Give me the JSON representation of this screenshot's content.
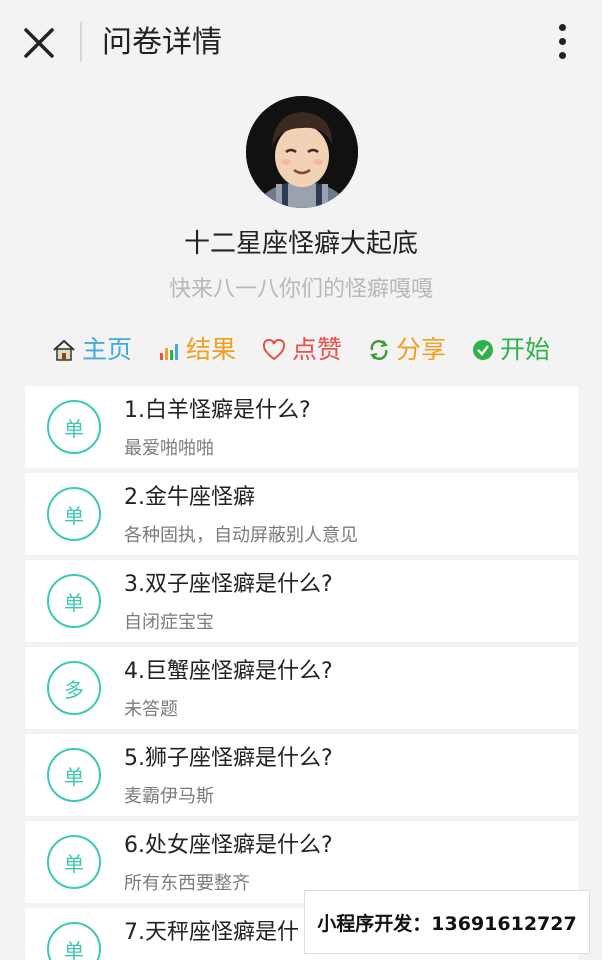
{
  "header": {
    "title": "问卷详情",
    "close_icon": "close-icon",
    "more_icon": "more-vertical-icon"
  },
  "survey": {
    "title": "十二星座怪癖大起底",
    "subtitle": "快来八一八你们的怪癖嘎嘎"
  },
  "actions": [
    {
      "label": "主页",
      "icon": "home-icon",
      "color": "#3fa9e0"
    },
    {
      "label": "结果",
      "icon": "bar-chart-icon",
      "color": "#f0a020"
    },
    {
      "label": "点赞",
      "icon": "heart-icon",
      "color": "#e8504a"
    },
    {
      "label": "分享",
      "icon": "refresh-share-icon",
      "color": "#f0a020"
    },
    {
      "label": "开始",
      "icon": "check-circle-icon",
      "color": "#2fb24a"
    }
  ],
  "questions": [
    {
      "badge": "单",
      "title": "1.白羊怪癖是什么?",
      "answer": "最爱啪啪啪"
    },
    {
      "badge": "单",
      "title": "2.金牛座怪癖",
      "answer": "各种固执，自动屏蔽别人意见"
    },
    {
      "badge": "单",
      "title": "3.双子座怪癖是什么?",
      "answer": "自闭症宝宝"
    },
    {
      "badge": "多",
      "title": "4.巨蟹座怪癖是什么?",
      "answer": "未答题"
    },
    {
      "badge": "单",
      "title": "5.狮子座怪癖是什么?",
      "answer": "麦霸伊马斯"
    },
    {
      "badge": "单",
      "title": "6.处女座怪癖是什么?",
      "answer": "所有东西要整齐"
    },
    {
      "badge": "单",
      "title": "7.天秤座怪癖是什",
      "answer": ""
    }
  ],
  "promo": {
    "text": "小程序开发：13691612727"
  },
  "colors": {
    "badge": "#3cc8b4",
    "background": "#f3f3f3"
  }
}
